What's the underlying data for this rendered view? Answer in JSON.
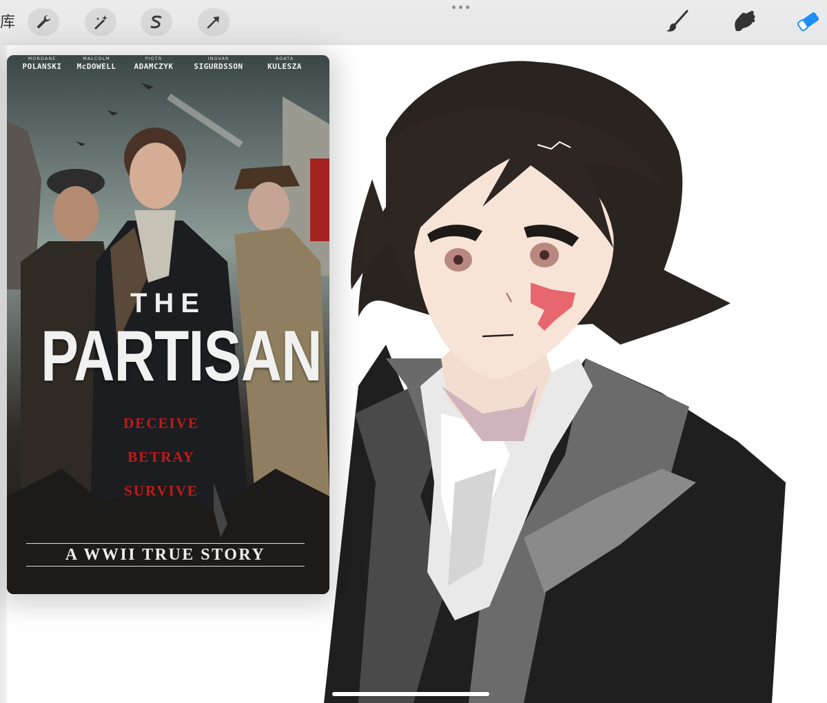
{
  "toolbar": {
    "gallery_label": "库",
    "left_tools": [
      {
        "name": "actions",
        "icon": "wrench-icon"
      },
      {
        "name": "adjustments",
        "icon": "magic-wand-icon"
      },
      {
        "name": "selection",
        "icon": "selection-s-icon"
      },
      {
        "name": "transform",
        "icon": "arrow-cursor-icon"
      }
    ],
    "more_icon": "more-dots-icon",
    "right_tools": [
      {
        "name": "brush",
        "icon": "brush-icon",
        "color": "#333333"
      },
      {
        "name": "smudge",
        "icon": "smudge-hand-icon",
        "color": "#333333"
      },
      {
        "name": "eraser",
        "icon": "eraser-icon",
        "color": "#1e8ef5",
        "active": true
      }
    ]
  },
  "reference_poster": {
    "cast": [
      {
        "first": "MORGANE",
        "last": "POLANSKI"
      },
      {
        "first": "MALCOLM",
        "last": "McDOWELL"
      },
      {
        "first": "PIOTR",
        "last": "ADAMCZYK"
      },
      {
        "first": "INGVAR",
        "last": "SIGURDSSON"
      },
      {
        "first": "AGATA",
        "last": "KULESZA"
      }
    ],
    "title_the": "THE",
    "title_main": "PARTISAN",
    "taglines": [
      "DECEIVE",
      "BETRAY",
      "SURVIVE"
    ],
    "subtitle": "A WWII TRUE STORY"
  },
  "colors": {
    "accent_eraser": "#1e8ef5",
    "tagline_red": "#c11b1b",
    "toolbar_bg": "#e8e8e8"
  }
}
